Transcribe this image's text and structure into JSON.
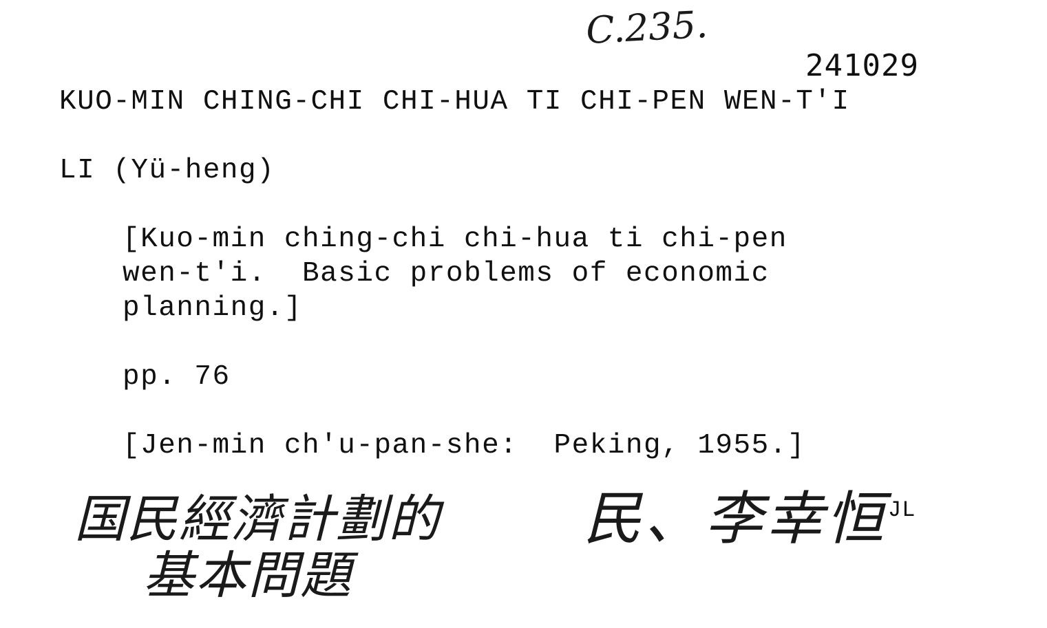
{
  "handwritten": {
    "shelfmark": "C.235.",
    "han_title_line1": "国民經濟計劃的",
    "han_title_line2": "基本問題",
    "han_author": "民、李幸恒"
  },
  "accession": "241029",
  "heading": "KUO-MIN CHING-CHI CHI-HUA TI CHI-PEN WEN-T'I",
  "author": "LI (Yü-heng)",
  "bracket_title": {
    "line1": "[Kuo-min ching-chi chi-hua ti chi-pen",
    "line2": "wen-t'i.  Basic problems of economic",
    "line3": "planning.]"
  },
  "pages": "pp. 76",
  "imprint": "[Jen-min ch'u-pan-she:  Peking, 1955.]",
  "initials": "JL"
}
